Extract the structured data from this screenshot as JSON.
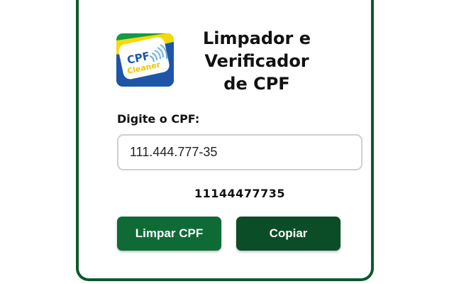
{
  "app": {
    "title_lines": [
      "Limpador e",
      "Verificador",
      "de CPF"
    ],
    "logo": {
      "icon": "fingerprint-icon",
      "text_line1": "CPF",
      "text_line2": "Cleaner"
    }
  },
  "form": {
    "label": "Digite o CPF:",
    "input_value": "111.444.777-35",
    "result": "11144477735"
  },
  "buttons": {
    "clean_label": "Limpar CPF",
    "copy_label": "Copiar"
  },
  "colors": {
    "primary_green": "#0f6b36",
    "dark_green": "#0b4d26",
    "brazil_yellow": "#f5d90a",
    "brazil_blue": "#1e55a8"
  }
}
